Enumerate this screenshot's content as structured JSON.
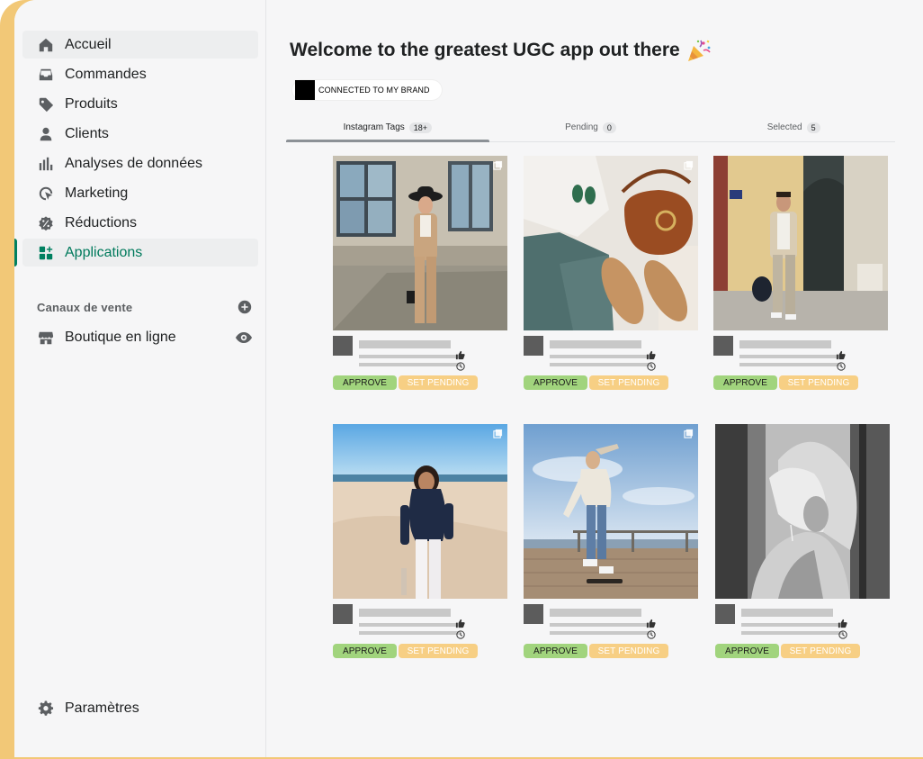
{
  "sidebar": {
    "items": [
      {
        "label": "Accueil",
        "icon": "home-icon"
      },
      {
        "label": "Commandes",
        "icon": "inbox-icon"
      },
      {
        "label": "Produits",
        "icon": "tag-icon"
      },
      {
        "label": "Clients",
        "icon": "person-icon"
      },
      {
        "label": "Analyses de données",
        "icon": "analytics-icon"
      },
      {
        "label": "Marketing",
        "icon": "target-icon"
      },
      {
        "label": "Réductions",
        "icon": "discount-icon"
      },
      {
        "label": "Applications",
        "icon": "apps-icon",
        "active": true
      }
    ],
    "sales_channels_title": "Canaux de vente",
    "online_store_label": "Boutique en ligne",
    "settings_label": "Paramètres"
  },
  "main": {
    "title": "Welcome to the greatest UGC app out there",
    "title_emoji": "party-popper-icon",
    "brand_label": "CONNECTED TO MY BRAND",
    "tabs": [
      {
        "label": "Instagram Tags",
        "count": "18+"
      },
      {
        "label": "Pending",
        "count": "0"
      },
      {
        "label": "Selected",
        "count": "5"
      }
    ],
    "approve_label": "APPROVE",
    "set_pending_label": "SET PENDING"
  },
  "colors": {
    "accent": "#008060",
    "frame": "#f2c877",
    "approve": "#a1d47d",
    "pending": "#f7cf84"
  }
}
